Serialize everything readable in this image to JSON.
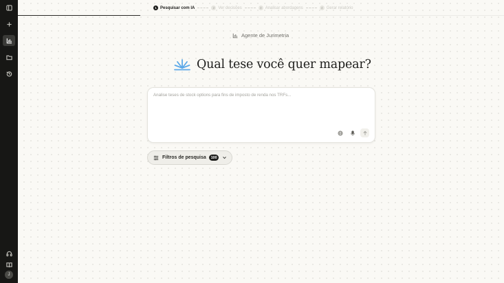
{
  "sidebar": {
    "top_icons": [
      "panel-toggle-icon",
      "plus-icon",
      "chart-icon",
      "folder-icon",
      "history-icon"
    ],
    "active_item": "chart-icon",
    "bottom_icons": [
      "headset-icon",
      "book-icon"
    ],
    "avatar_initial": "J"
  },
  "steps": [
    {
      "number": "1",
      "label": "Pesquisar com IA",
      "active": true
    },
    {
      "number": "2",
      "label": "Ver decisões",
      "active": false
    },
    {
      "number": "3",
      "label": "Analisar abordagens",
      "active": false
    },
    {
      "number": "4",
      "label": "Gerar relatório",
      "active": false
    }
  ],
  "agent": {
    "label": "Agente de Jurimetria",
    "icon": "chart-icon"
  },
  "headline": {
    "text": "Qual tese você quer mapear?",
    "icon": "sparkle-rays-icon",
    "icon_color": "#5aa8e8"
  },
  "prompt": {
    "placeholder": "Analise teses de stock options para fins de imposto de renda nos TRFs...",
    "value": ""
  },
  "filters": {
    "label": "Filtros de pesquisa",
    "count": "100"
  },
  "colors": {
    "sidebar_bg": "#171715",
    "accent_blue": "#5aa8e8",
    "page_bg": "#faf9f5"
  }
}
